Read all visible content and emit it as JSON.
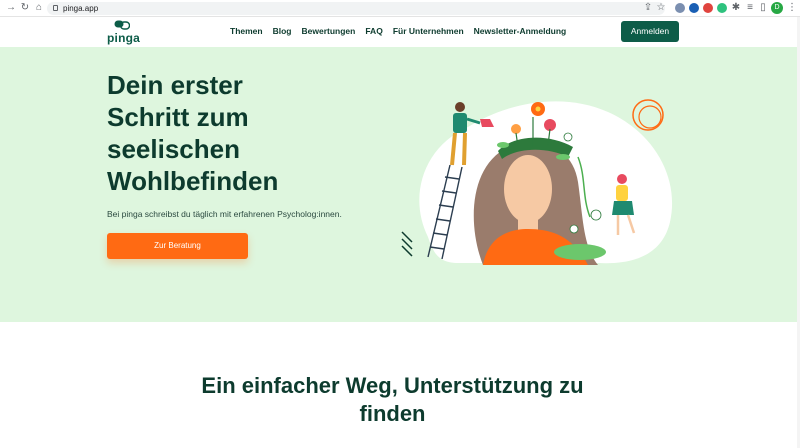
{
  "browser": {
    "url": "pinga.app",
    "profile_initial": "D"
  },
  "header": {
    "logo_text": "pinga",
    "nav": [
      {
        "label": "Themen"
      },
      {
        "label": "Blog"
      },
      {
        "label": "Bewertungen"
      },
      {
        "label": "FAQ"
      },
      {
        "label": "Für Unternehmen"
      },
      {
        "label": "Newsletter-Anmeldung"
      }
    ],
    "login_label": "Anmelden"
  },
  "hero": {
    "title": "Dein erster Schritt zum seelischen Wohlbefinden",
    "subtitle": "Bei pinga schreibst du täglich mit erfahrenen Psycholog:innen.",
    "cta_label": "Zur Beratung",
    "illustration": "woman-head-garden-illustration"
  },
  "section": {
    "title": "Ein einfacher Weg, Unterstützung zu finden"
  },
  "colors": {
    "brand_green": "#0d5c48",
    "hero_bg": "#def6de",
    "cta_orange": "#ff6a13",
    "text_dark": "#0d3b2e"
  }
}
